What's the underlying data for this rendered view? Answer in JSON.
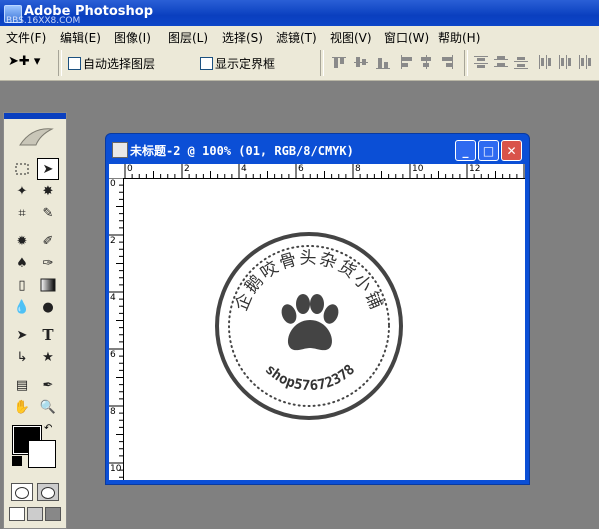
{
  "app": {
    "title": "Adobe Photoshop",
    "watermark": "BBS.16XX8.COM"
  },
  "menu": [
    "文件(F)",
    "编辑(E)",
    "图像(I)",
    "图层(L)",
    "选择(S)",
    "滤镜(T)",
    "视图(V)",
    "窗口(W)",
    "帮助(H)"
  ],
  "options": {
    "auto_select": "自动选择图层",
    "show_bounds": "显示定界框"
  },
  "document": {
    "title": "未标题-2 @ 100% (01, RGB/8/CMYK)"
  },
  "ruler": {
    "h_ticks": [
      "0",
      "2",
      "4",
      "6",
      "8",
      "10",
      "12"
    ],
    "v_ticks": [
      "0",
      "2",
      "4",
      "6",
      "8",
      "10"
    ]
  },
  "stamp": {
    "arc_text": "企鹅咬骨头杂货小铺",
    "bottom_text": "shop57672378",
    "icon": "paw-print-icon"
  },
  "colors": {
    "title_bar": "#0a3fbf",
    "panel_bg": "#ece9d8",
    "workspace": "#808080",
    "stamp": "#444444"
  }
}
